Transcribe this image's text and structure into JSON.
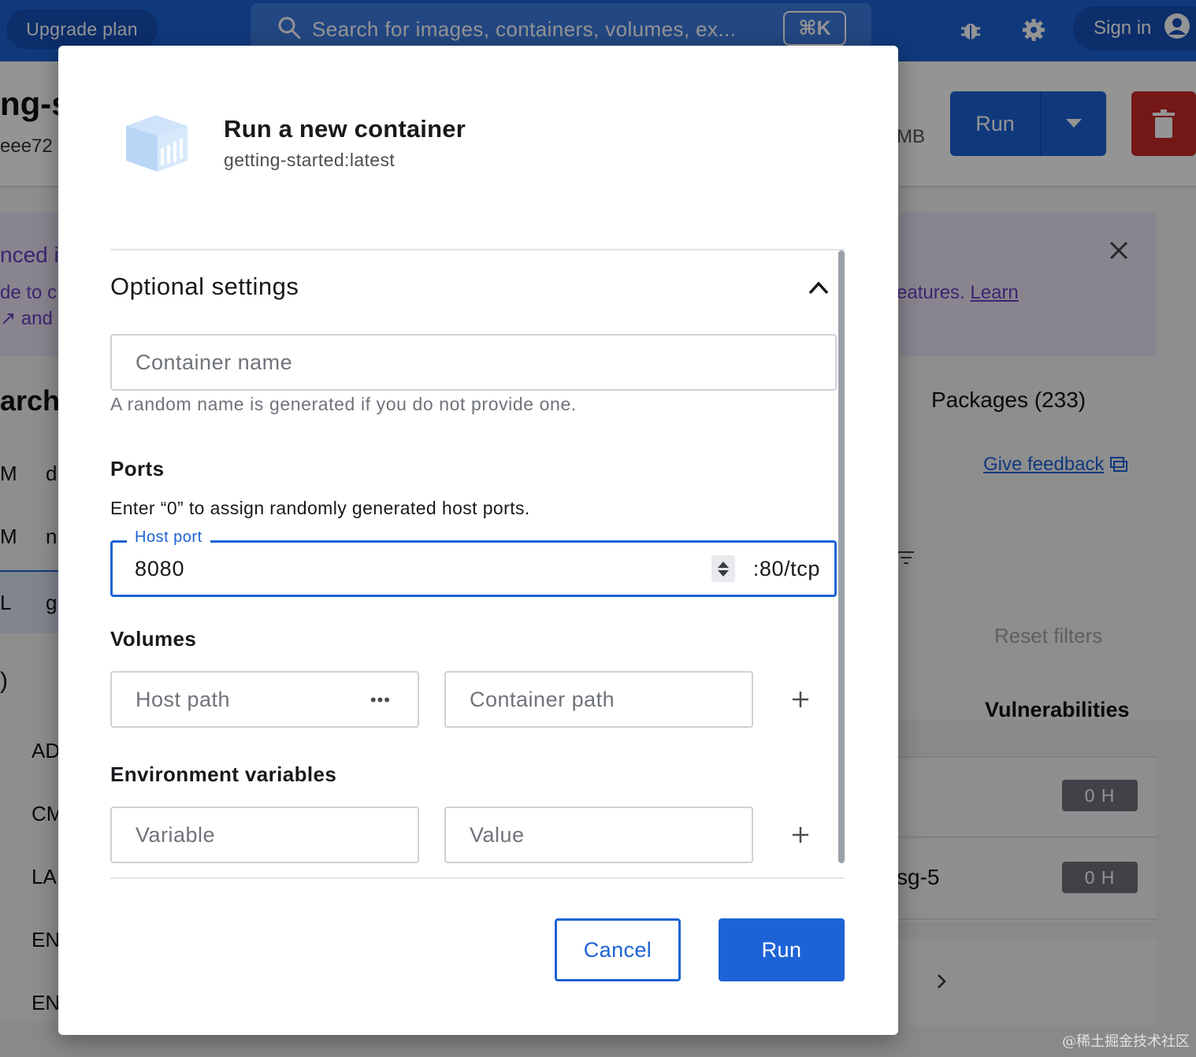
{
  "topbar": {
    "upgrade_label": "Upgrade plan",
    "search_placeholder": "Search for images, containers, volumes, ex...",
    "search_shortcut": "⌘K",
    "signin_label": "Sign in"
  },
  "background": {
    "image_title_fragment": "ng-s",
    "image_hash_fragment": "eee72",
    "size_fragment": "MB",
    "run_label": "Run",
    "banner_line1": "nced i",
    "banner_line2": "de to c",
    "banner_line3": "and",
    "banner_learn_prefix": "eatures. ",
    "banner_learn_link": "Learn",
    "hierarchy_fragment": "archy",
    "packages_label": "Packages (233)",
    "feedback_label": "Give feedback",
    "row_letters": [
      "M",
      "d",
      "M",
      "n",
      "L",
      "g"
    ],
    "reset_filters_label": "Reset filters",
    "vulnerabilities_label": "Vulnerabilities",
    "badge1": "0 H",
    "badge2": "0 H",
    "package_fragment": "sg-5",
    "lower_left": [
      ")",
      "AD",
      "CM",
      "LA",
      "EN",
      "EN"
    ],
    "watermark": "@稀土掘金技术社区"
  },
  "modal": {
    "title": "Run a new container",
    "subtitle": "getting-started:latest",
    "optional_settings_label": "Optional settings",
    "container_name_placeholder": "Container name",
    "container_name_hint": "A random name is generated if you do not provide one.",
    "ports": {
      "title": "Ports",
      "description": "Enter “0” to assign randomly generated host ports.",
      "host_port_label": "Host port",
      "host_port_value": "8080",
      "container_port_suffix": ":80/tcp"
    },
    "volumes": {
      "title": "Volumes",
      "host_path_placeholder": "Host path",
      "host_path_browse": "•••",
      "container_path_placeholder": "Container path"
    },
    "env": {
      "title": "Environment variables",
      "variable_placeholder": "Variable",
      "value_placeholder": "Value"
    },
    "cancel_label": "Cancel",
    "run_label": "Run"
  }
}
